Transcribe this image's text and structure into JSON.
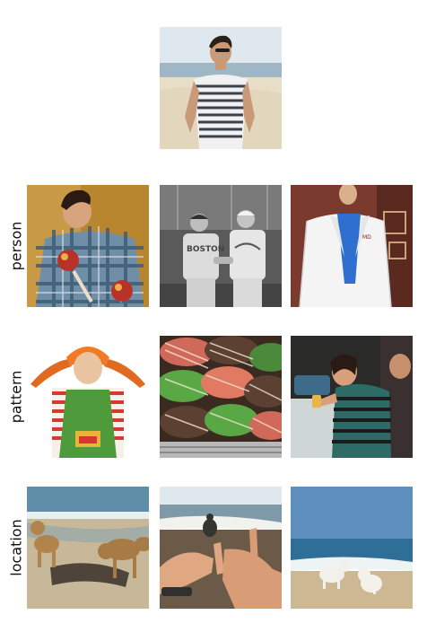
{
  "rows": [
    {
      "label": ""
    },
    {
      "label": "person"
    },
    {
      "label": "pattern"
    },
    {
      "label": "location"
    }
  ],
  "images": {
    "query": "man-striped-shirt-beach-photo",
    "person_1": "man-plaid-shirt-maracas-photo",
    "person_2": "baseball-players-handshake-photo",
    "person_3": "man-lab-coat-photo",
    "pattern_1": "girl-striped-shirt-orange-braids-photo",
    "pattern_2": "striped-cookies-photo",
    "pattern_3": "woman-striped-swimsuit-photo",
    "location_1": "dogs-on-beach-photo",
    "location_2": "hands-holding-turtle-beach-photo",
    "location_3": "white-dogs-on-beach-photo"
  }
}
